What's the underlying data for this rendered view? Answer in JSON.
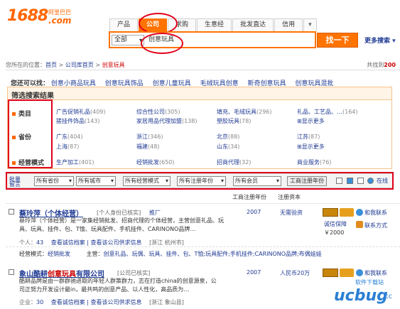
{
  "logo": {
    "main": "1688",
    "com": ".com",
    "cn": "阿里巴巴"
  },
  "tabs": [
    "产品",
    "公司",
    "求购",
    "生意经",
    "批发直达",
    "信用",
    "▾"
  ],
  "search": {
    "category": "全部",
    "query": "创意玩具",
    "button": "找一下",
    "more": "更多搜索 ▾"
  },
  "breadcrumb": {
    "prefix": "您所在的位置：",
    "home": "首页",
    "sep1": " > ",
    "lib": "公司库首页",
    "sep2": " > ",
    "current": "创意玩具"
  },
  "total": {
    "label": "共找到",
    "count": "200"
  },
  "also": {
    "label": "您还可以找：",
    "items": [
      "创意小商品玩具",
      "创意玩具饰品",
      "创意儿童玩具",
      "毛绒玩具创意",
      "新奇创意玩具",
      "创意玩具混批"
    ]
  },
  "filter": {
    "title": "筛选搜索结果",
    "labels": [
      "类目",
      "省份",
      "经营模式"
    ],
    "category": [
      {
        "name": "广告促销礼品",
        "count": "(409)"
      },
      {
        "name": "综合性公司",
        "count": "(305)"
      },
      {
        "name": "填充、毛绒玩具",
        "count": "(296)"
      },
      {
        "name": "礼品、工艺品、…",
        "count": "(164)"
      },
      {
        "name": "搓挂件饰品",
        "count": "(143)"
      },
      {
        "name": "家居用品代理加盟",
        "count": "(138)"
      },
      {
        "name": "塑胶玩具",
        "count": "(78)"
      },
      {
        "name": "显示更多",
        "count": ""
      }
    ],
    "province": [
      {
        "name": "广东",
        "count": "(404)"
      },
      {
        "name": "浙江",
        "count": "(346)"
      },
      {
        "name": "北京",
        "count": "(88)"
      },
      {
        "name": "江苏",
        "count": "(87)"
      },
      {
        "name": "上海",
        "count": "(87)"
      },
      {
        "name": "福建",
        "count": "(48)"
      },
      {
        "name": "山东",
        "count": "(34)"
      },
      {
        "name": "显示更多",
        "count": ""
      }
    ],
    "mode": [
      {
        "name": "生产加工",
        "count": "(401)"
      },
      {
        "name": "经销批发",
        "count": "(650)"
      },
      {
        "name": "招商代理",
        "count": "(32)"
      },
      {
        "name": "商业服务",
        "count": "(76)"
      }
    ]
  },
  "options": {
    "prefix_top": "批量",
    "prefix_bottom": "留言",
    "dropdowns": [
      "所有省份",
      "所有城市",
      "所有经营模式",
      "所有注册年份",
      "所有会员"
    ],
    "reg_button": "工商注册年份",
    "online": "在线"
  },
  "columns": {
    "year": "工商注册年份",
    "capital": "注册资本"
  },
  "results": [
    {
      "name": "蔡玲萍（个体经营）",
      "auth": "[个人身份已核实]",
      "tag": "推厂",
      "desc1": "蔡玲萍（个体经营）是一家集经销批发、招商代理的个体经营，主营创意礼品、玩",
      "desc2": "具、玩具、挂件、包、T恤、玩具配件、手机挂件、CARINONO品牌…",
      "rank": "个人：",
      "rank_val": "43",
      "links": "查看诚信档案 | 查看该公司供求信息",
      "loc": "[浙江 杭州市]",
      "year": "2007",
      "capital": "无需验资",
      "side1": "和我联系",
      "side2": "联系方式",
      "guarantee": "诚信保障",
      "amount": "￥2000",
      "mode_label": "经营模式：",
      "mode_val": "经销批发",
      "main_label": "主营：",
      "main_val": "创意礼品、玩偶、玩具、挂件、包、T恤;玩具配件;手机挂件;CARINONO品牌;布偶娃娃"
    },
    {
      "name": "象山酷耕创意玩具有限公司",
      "name_kw": "创意玩具",
      "auth": "[公司已核实]",
      "desc1": "酷耕品牌是由一群群驰进取的年轻人群策群力，志在打造china的创意源泉，公",
      "desc2": "司正努力开发设计最in，最共鸣的创意产品、以人性化，高品质为…",
      "rank": "企业：",
      "rank_val": "30",
      "links": "查看诚信档案 | 查看该公司供求信息",
      "loc": "[浙江 象山县]",
      "year": "2007",
      "capital": "人民币20万",
      "side1": "和我联系"
    }
  ],
  "watermark": {
    "main": "ucbug",
    "sub": ".cc",
    "top": "软件下载站"
  },
  "colors": {
    "brand": "#ff7300",
    "link": "#1f3a93",
    "highlight": "#e0001a"
  }
}
